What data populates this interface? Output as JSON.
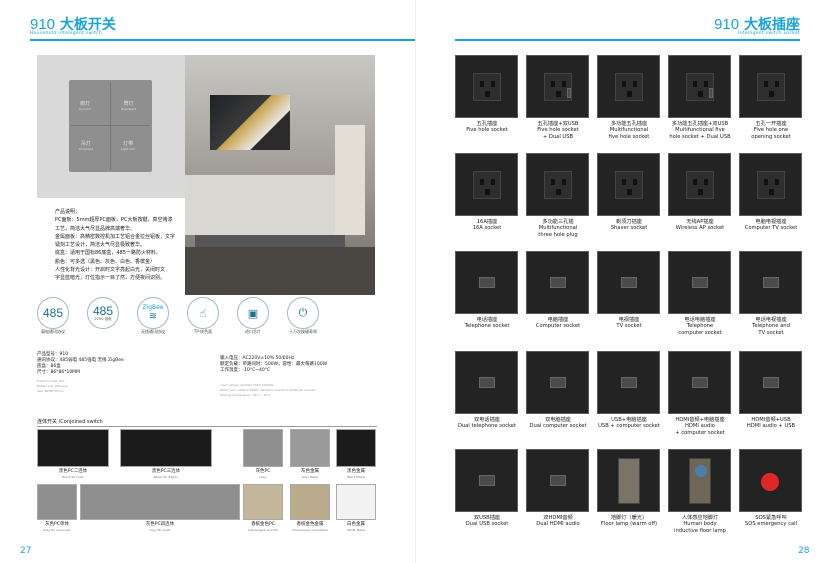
{
  "left": {
    "number": "910",
    "title": "大板开关",
    "subtitle": "Household intelligent switch",
    "page": "27",
    "panel_buttons": [
      {
        "cn": "廊灯",
        "en": "Corridor"
      },
      {
        "cn": "筒灯",
        "en": "Downlight"
      },
      {
        "cn": "吊灯",
        "en": "Droplight"
      },
      {
        "cn": "灯带",
        "en": "Light belt"
      }
    ],
    "product_desc": [
      "产品说明：",
      "PC面板：5mm超厚PC面板，PC大板按键，真空烤漆",
      "工艺，简洁大气尽显品牌高端奢华。",
      "金属面板：高精密数控机加工艺铝合金拉丝铝板，文字",
      "镭刻工艺设计，简洁大气尽显极致奢华。",
      "底盒：适用于国标86底盒，485一路防火材料。",
      "颜色：可多选（黑色、灰色、白色、香槟金）",
      "人性化背光设计：开启时文字亮起白光，关闭时文",
      "字显蓝暗光，灯位指示一目了然，方便夜间识别。"
    ],
    "features": [
      {
        "big": "485",
        "small": "",
        "label": "弱电通讯协议"
      },
      {
        "big": "485",
        "small": "220V 强电",
        "label": "220V 强电"
      },
      {
        "big": "ZigBee",
        "small": "",
        "label": "无线通讯协议"
      },
      {
        "big": "",
        "small": "",
        "label": "TP-纹色面"
      },
      {
        "big": "",
        "small": "",
        "label": "进口芯片"
      },
      {
        "big": "",
        "small": "",
        "label": "十万次按键寿命"
      }
    ],
    "specs_left": [
      "产品型号：910",
      "通讯协议：485弱电  485强电  无线  ZigBee",
      "底盒：86盒",
      "尺寸：86*86*10MM"
    ],
    "specs_left_en": [
      "Product model: 910",
      "Bottom box: 86 boxes",
      "Size: 86*86*10mm"
    ],
    "specs_right": [
      "输入电压：AC220V±10%  50/60Hz",
      "额定负载：单路同时：500W，容性：最大每路100W",
      "工作温度：-10°C~40°C"
    ],
    "specs_right_en": [
      "Input voltage: AC220V ±10% 50/60Hz",
      "Rated load: resistive 500W, capacitive maximum 100W per channel",
      "Working temperature: -10°C ~ 40°C"
    ],
    "combo_header": "连体开关 /Conjoined switch",
    "combos": [
      {
        "cn": "黑色PC二连体",
        "en": "Black PC Duet"
      },
      {
        "cn": "黑色PC三连体",
        "en": "Black PC Triplex"
      },
      {
        "cn": "灰色PC",
        "en": "Grey"
      },
      {
        "cn": "灰色金属",
        "en": "Grey Metal"
      },
      {
        "cn": "黑色金属",
        "en": "Black Metal"
      },
      {
        "cn": "灰色PC单体",
        "en": "Grey PC monomer"
      },
      {
        "cn": "灰色PC四连体",
        "en": "Grey PC Quad"
      },
      {
        "cn": "香槟金色PC",
        "en": "Champagne Gold PC"
      },
      {
        "cn": "香槟金色金属",
        "en": "Champagne Gold Metal"
      },
      {
        "cn": "白色金属",
        "en": "White Metal"
      }
    ]
  },
  "right": {
    "number": "910",
    "title": "大板插座",
    "subtitle": "Intelligent switch socket",
    "page": "28",
    "sockets": [
      {
        "cn": "五孔插座",
        "en": "Five hole socket"
      },
      {
        "cn": "五孔插座+双USB",
        "en": "Five hole socket\n+ Dual USB"
      },
      {
        "cn": "多功能五孔插座",
        "en": "Multifunctional\nfive hole socket"
      },
      {
        "cn": "多功能五孔插座+双USB",
        "en": "Multifunctional five\nhole socket + Dual USB"
      },
      {
        "cn": "五孔一开插座",
        "en": "Five hole one\nopening socket"
      },
      {
        "cn": "16A插座",
        "en": "16A socket"
      },
      {
        "cn": "多功能三孔插",
        "en": "Multifunctional\nthree hole plug"
      },
      {
        "cn": "剃须刀插座",
        "en": "Shaver socket"
      },
      {
        "cn": "无线AP插座",
        "en": "Wireless AP socket"
      },
      {
        "cn": "电脑电视插座",
        "en": "Computer TV socket"
      },
      {
        "cn": "电话插座",
        "en": "Telephone socket"
      },
      {
        "cn": "电脑插座",
        "en": "Computer socket"
      },
      {
        "cn": "电视插座",
        "en": "TV socket"
      },
      {
        "cn": "电话电脑插座",
        "en": "Telephone\ncomputer socket"
      },
      {
        "cn": "电话电视插座",
        "en": "Telephone and\nTV socket"
      },
      {
        "cn": "双电话插座",
        "en": "Dual telephone socket"
      },
      {
        "cn": "双电脑插座",
        "en": "Dual computer socket"
      },
      {
        "cn": "USB+电脑插座",
        "en": "USB + computer socket"
      },
      {
        "cn": "HDMI音频+电脑插座",
        "en": "HDMI audio\n+ computer socket"
      },
      {
        "cn": "HDMI音频+USB",
        "en": "HDMI audio + USB"
      },
      {
        "cn": "双USB插座",
        "en": "Dual USB socket"
      },
      {
        "cn": "双HDMI音频",
        "en": "Dual HDMI audio"
      },
      {
        "cn": "地脚灯（暖光）",
        "en": "Floor lamp (warm off)"
      },
      {
        "cn": "人体感应地脚灯",
        "en": "Human body\ninductive floor lamp"
      },
      {
        "cn": "SOS紧急呼叫",
        "en": "SOS emergency call"
      }
    ]
  },
  "colors": {
    "accent": "#1aa3d8",
    "tile": "#232323"
  }
}
